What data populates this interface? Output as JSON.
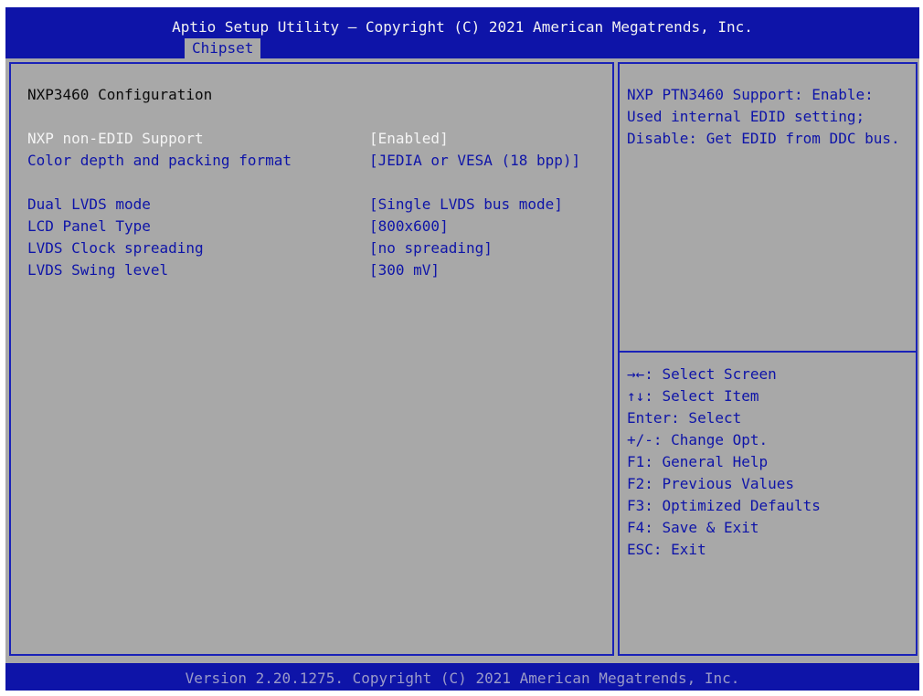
{
  "header": {
    "title": "Aptio Setup Utility – Copyright (C) 2021 American Megatrends, Inc.",
    "active_tab": "Chipset"
  },
  "main": {
    "section_title": "NXP3460 Configuration",
    "settings": [
      {
        "label": "NXP non-EDID Support",
        "value": "[Enabled]",
        "selected": true
      },
      {
        "label": "Color depth and packing format",
        "value": "[JEDIA or VESA (18 bpp)]",
        "selected": false
      },
      {
        "label": "Dual LVDS mode",
        "value": "[Single LVDS bus mode]",
        "selected": false
      },
      {
        "label": "LCD Panel Type",
        "value": "[800x600]",
        "selected": false
      },
      {
        "label": "LVDS Clock spreading",
        "value": "[no spreading]",
        "selected": false
      },
      {
        "label": "LVDS Swing level",
        "value": "[300 mV]",
        "selected": false
      }
    ]
  },
  "help": {
    "description_lines": [
      "NXP PTN3460 Support: Enable:",
      "Used internal EDID setting;",
      "Disable: Get EDID from DDC bus."
    ],
    "keys": [
      "→←: Select Screen",
      "↑↓: Select Item",
      "Enter: Select",
      "+/-: Change Opt.",
      "F1: General Help",
      "F2: Previous Values",
      "F3: Optimized Defaults",
      "F4: Save & Exit",
      "ESC: Exit"
    ]
  },
  "footer": {
    "text": "Version 2.20.1275. Copyright (C) 2021 American Megatrends, Inc."
  },
  "colors": {
    "bar_blue": "#0e14a8",
    "panel_gray": "#a8a8a8",
    "selected_text": "#f4f4f4",
    "item_text": "#0e14a8"
  }
}
